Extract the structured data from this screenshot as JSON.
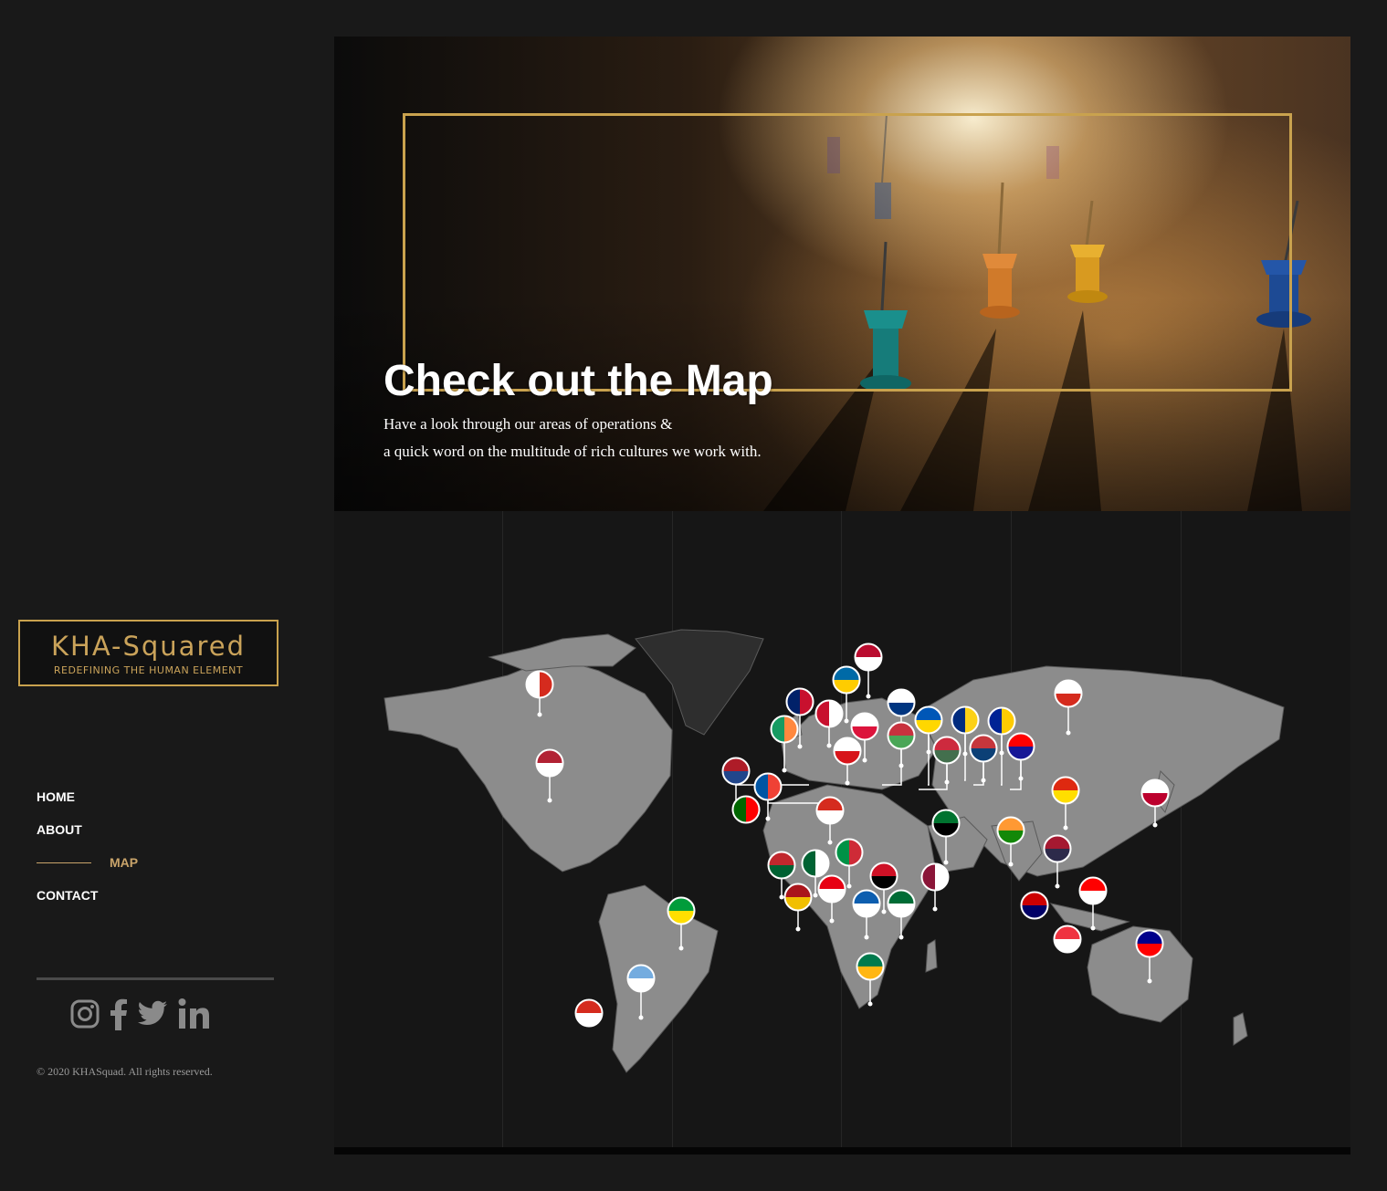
{
  "brand": {
    "logo_main": "KHA-Squared",
    "logo_sub": "REDEFINING THE HUMAN ELEMENT"
  },
  "nav": {
    "items": [
      {
        "label": "HOME",
        "active": false
      },
      {
        "label": "ABOUT",
        "active": false
      },
      {
        "label": "MAP",
        "active": true
      },
      {
        "label": "CONTACT",
        "active": false
      }
    ]
  },
  "social": [
    "instagram-icon",
    "facebook-icon",
    "twitter-icon",
    "linkedin-icon"
  ],
  "footer": {
    "copyright": "© 2020 KHASquad. All rights reserved."
  },
  "hero": {
    "title": "Check out the Map",
    "subtitle_line1": "Have a look through our areas of operations &",
    "subtitle_line2": "a quick word on the multitude of rich cultures we work with."
  },
  "colors": {
    "background": "#191919",
    "gold": "#c9a24e",
    "nav_active": "#c9a46a",
    "map_land": "#8c8c8c"
  },
  "map": {
    "flags": [
      "Canada",
      "United States",
      "Brazil",
      "Argentina",
      "Chile",
      "Norway",
      "Sweden",
      "United Kingdom",
      "Denmark",
      "Finland",
      "Ireland",
      "Poland",
      "Ukraine",
      "Romania",
      "Bosnia and Herzegovina",
      "Russia",
      "Belarus",
      "Netherlands",
      "Czech Republic",
      "Hungary",
      "Serbia",
      "Croatia",
      "France",
      "Portugal",
      "Switzerland",
      "Spain",
      "Morocco",
      "Algeria",
      "Tunisia",
      "Italy",
      "Egypt",
      "Greece",
      "Saudi Arabia",
      "United Arab Emirates",
      "Qatar",
      "India",
      "China",
      "Japan",
      "Thailand",
      "Malaysia",
      "Indonesia",
      "Singapore",
      "Australia",
      "South Africa"
    ]
  }
}
